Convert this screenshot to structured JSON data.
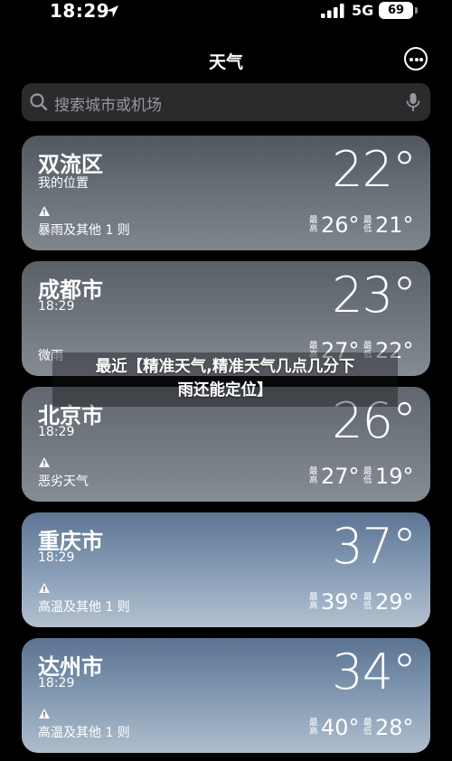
{
  "status_bar": {
    "time": "18:29",
    "network": "5G",
    "battery": "69"
  },
  "nav": {
    "title": "天气"
  },
  "search": {
    "placeholder": "搜索城市或机场"
  },
  "cards": [
    {
      "city": "双流区",
      "subtitle": "我的位置",
      "condition": "暴雨及其他 1 则",
      "temp": "22°",
      "high_label_1": "最",
      "high_label_2": "高",
      "high": "26°",
      "low_label_1": "最",
      "low_label_2": "低",
      "low": "21°"
    },
    {
      "city": "成都市",
      "subtitle": "18:29",
      "condition": "微雨",
      "temp": "23°",
      "high_label_1": "最",
      "high_label_2": "高",
      "high": "27°",
      "low_label_1": "最",
      "low_label_2": "低",
      "low": "22°"
    },
    {
      "city": "北京市",
      "subtitle": "18:29",
      "condition": "恶劣天气",
      "temp": "26°",
      "high_label_1": "最",
      "high_label_2": "高",
      "high": "27°",
      "low_label_1": "最",
      "low_label_2": "低",
      "low": "19°"
    },
    {
      "city": "重庆市",
      "subtitle": "18:29",
      "condition": "高温及其他 1 则",
      "temp": "37°",
      "high_label_1": "最",
      "high_label_2": "高",
      "high": "39°",
      "low_label_1": "最",
      "low_label_2": "低",
      "low": "29°"
    },
    {
      "city": "达州市",
      "subtitle": "18:29",
      "condition": "高温及其他 1 则",
      "temp": "34°",
      "high_label_1": "最",
      "high_label_2": "高",
      "high": "40°",
      "low_label_1": "最",
      "low_label_2": "低",
      "low": "28°"
    }
  ],
  "overlay": {
    "line1": "最近【精准天气,精准天气几点几分下",
    "line2": "雨还能定位】"
  },
  "icons": [
    "location-arrow-icon",
    "signal-icon",
    "more-icon",
    "search-icon",
    "mic-icon",
    "warning-icon"
  ]
}
